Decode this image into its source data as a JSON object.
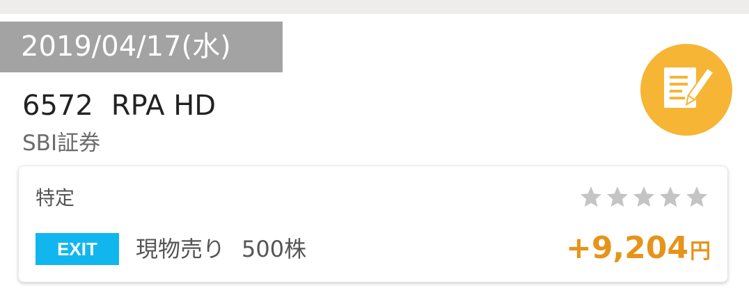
{
  "colors": {
    "date_banner_bg": "#a3a3a3",
    "note_button_bg": "#f6b534",
    "exit_badge_bg": "#12b6ee",
    "profit_color": "#e69419",
    "star_color": "#c4c4c4"
  },
  "entry": {
    "date": "2019/04/17(水)",
    "stock_code": "6572",
    "stock_name": "RPA HD",
    "broker": "SBI証券",
    "note_icon": "memo-pencil-icon",
    "card": {
      "account_type": "特定",
      "rating": {
        "filled": 0,
        "max": 5,
        "icon": "star-icon"
      },
      "badge": "EXIT",
      "trade_type": "現物売り",
      "quantity": "500株",
      "profit": "+9,204",
      "profit_unit": "円"
    }
  }
}
